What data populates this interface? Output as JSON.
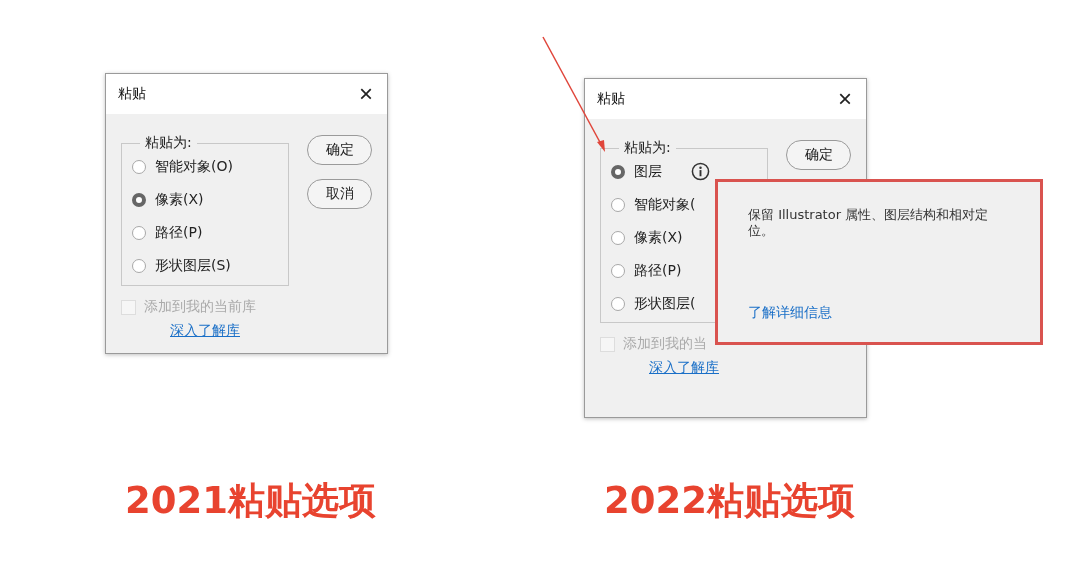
{
  "panels": [
    {
      "dialog": {
        "title": "粘贴",
        "close": "×",
        "group_label": "粘贴为:",
        "options": [
          {
            "label": "智能对象(O)",
            "selected": false,
            "info": false
          },
          {
            "label": "像素(X)",
            "selected": true,
            "info": false
          },
          {
            "label": "路径(P)",
            "selected": false,
            "info": false
          },
          {
            "label": "形状图层(S)",
            "selected": false,
            "info": false
          }
        ],
        "buttons": [
          "确定",
          "取消"
        ],
        "checkbox": {
          "label": "添加到我的当前库",
          "checked": false,
          "disabled": true
        },
        "link": "深入了解库"
      },
      "caption": "2021粘贴选项"
    },
    {
      "dialog": {
        "title": "粘贴",
        "close": "×",
        "group_label": "粘贴为:",
        "options": [
          {
            "label": "图层",
            "selected": true,
            "info": true
          },
          {
            "label": "智能对象(",
            "selected": false,
            "info": false
          },
          {
            "label": "像素(X)",
            "selected": false,
            "info": false
          },
          {
            "label": "路径(P)",
            "selected": false,
            "info": false
          },
          {
            "label": "形状图层(",
            "selected": false,
            "info": false
          }
        ],
        "buttons": [
          "确定"
        ],
        "checkbox": {
          "label": "添加到我的当",
          "checked": false,
          "disabled": true
        },
        "link": "深入了解库",
        "tooltip": {
          "text": "保留 Illustrator 属性、图层结构和相对定位。",
          "link": "了解详细信息"
        }
      },
      "caption": "2022粘贴选项"
    }
  ]
}
